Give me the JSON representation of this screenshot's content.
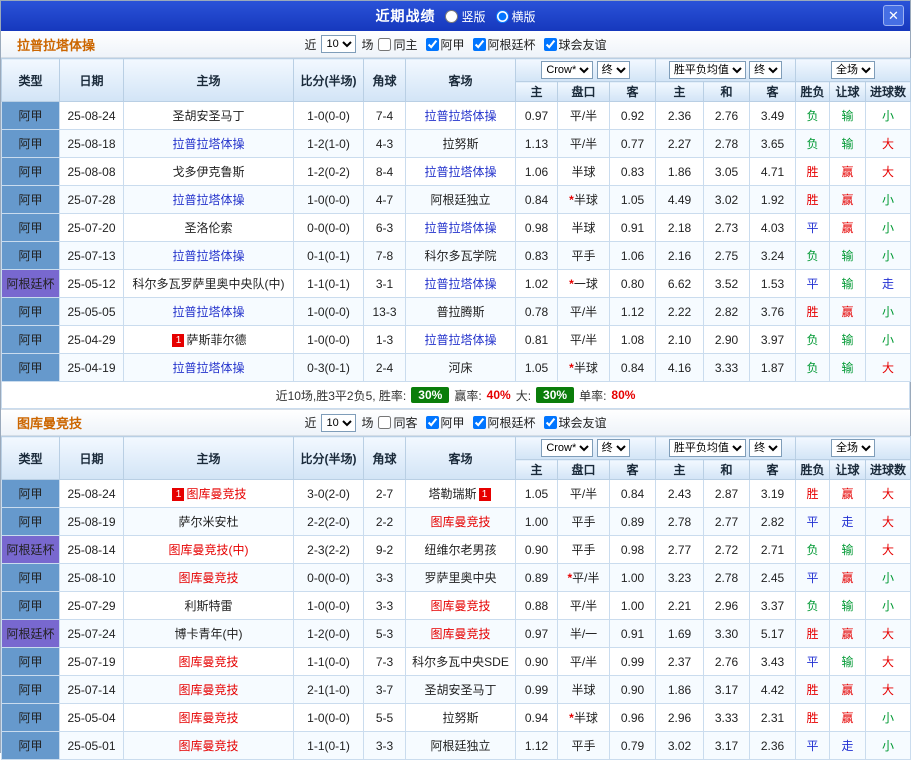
{
  "topbar": {
    "title": "近期战绩",
    "layout_options": [
      {
        "label": "竖版",
        "selected": false
      },
      {
        "label": "横版",
        "selected": true
      }
    ],
    "close_label": "✕"
  },
  "filters_common": {
    "near": "近",
    "count": "10",
    "games": "场"
  },
  "header": {
    "col_type": "类型",
    "col_date": "日期",
    "col_home": "主场",
    "col_score": "比分(半场)",
    "col_corner": "角球",
    "col_away": "客场",
    "odds_book": "Crow*",
    "odds_final": "终",
    "avg_name": "胜平负均值",
    "avg_final": "终",
    "full": "全场",
    "sub_home": "主",
    "sub_handicap": "盘口",
    "sub_away": "客",
    "sub_h": "主",
    "sub_d": "和",
    "sub_a": "客",
    "sub_result": "胜负",
    "sub_handicap_result": "让球",
    "sub_goals": "进球数"
  },
  "colors": {
    "topbar_bg": "#1c43cb",
    "league": {
      "阿甲": "#6699cc",
      "阿根廷杯": "#7868cf"
    },
    "result": {
      "胜": "#e60000",
      "赢": "#e60000",
      "大": "#e60000",
      "负": "#009933",
      "输": "#009933",
      "小": "#009933",
      "平": "#2230d2",
      "走": "#2230d2"
    },
    "score": "#e60000",
    "star": "#e60000",
    "badge_green": "#0a7d0a"
  },
  "sections": [
    {
      "title": "拉普拉塔体操",
      "focus_color": "#2433cc",
      "filters": [
        {
          "label": "同主",
          "checked": false
        },
        {
          "label": "阿甲",
          "checked": true
        },
        {
          "label": "阿根廷杯",
          "checked": true
        },
        {
          "label": "球会友谊",
          "checked": true
        }
      ],
      "rows": [
        {
          "type": "阿甲",
          "date": "25-08-24",
          "home": {
            "name": "圣胡安圣马丁"
          },
          "score": "1-0(0-0)",
          "corners": "7-4",
          "away": {
            "name": "拉普拉塔体操",
            "focus": true
          },
          "odds": [
            "0.97",
            "平/半",
            "0.92"
          ],
          "avg": [
            "2.36",
            "2.76",
            "3.49"
          ],
          "result": [
            "负",
            "输",
            "小"
          ]
        },
        {
          "type": "阿甲",
          "date": "25-08-18",
          "home": {
            "name": "拉普拉塔体操",
            "focus": true
          },
          "score": "1-2(1-0)",
          "corners": "4-3",
          "away": {
            "name": "拉努斯"
          },
          "odds": [
            "1.13",
            "平/半",
            "0.77"
          ],
          "avg": [
            "2.27",
            "2.78",
            "3.65"
          ],
          "result": [
            "负",
            "输",
            "大"
          ]
        },
        {
          "type": "阿甲",
          "date": "25-08-08",
          "home": {
            "name": "戈多伊克鲁斯"
          },
          "score": "1-2(0-2)",
          "corners": "8-4",
          "away": {
            "name": "拉普拉塔体操",
            "focus": true
          },
          "odds": [
            "1.06",
            "半球",
            "0.83"
          ],
          "avg": [
            "1.86",
            "3.05",
            "4.71"
          ],
          "result": [
            "胜",
            "赢",
            "大"
          ]
        },
        {
          "type": "阿甲",
          "date": "25-07-28",
          "home": {
            "name": "拉普拉塔体操",
            "focus": true
          },
          "score": "1-0(0-0)",
          "corners": "4-7",
          "away": {
            "name": "阿根廷独立"
          },
          "odds": [
            "0.84",
            "*半球",
            "1.05"
          ],
          "avg": [
            "4.49",
            "3.02",
            "1.92"
          ],
          "result": [
            "胜",
            "赢",
            "小"
          ]
        },
        {
          "type": "阿甲",
          "date": "25-07-20",
          "home": {
            "name": "圣洛伦索"
          },
          "score": "0-0(0-0)",
          "corners": "6-3",
          "away": {
            "name": "拉普拉塔体操",
            "focus": true
          },
          "odds": [
            "0.98",
            "半球",
            "0.91"
          ],
          "avg": [
            "2.18",
            "2.73",
            "4.03"
          ],
          "result": [
            "平",
            "赢",
            "小"
          ]
        },
        {
          "type": "阿甲",
          "date": "25-07-13",
          "home": {
            "name": "拉普拉塔体操",
            "focus": true
          },
          "score": "0-1(0-1)",
          "corners": "7-8",
          "away": {
            "name": "科尔多瓦学院"
          },
          "odds": [
            "0.83",
            "平手",
            "1.06"
          ],
          "avg": [
            "2.16",
            "2.75",
            "3.24"
          ],
          "result": [
            "负",
            "输",
            "小"
          ]
        },
        {
          "type": "阿根廷杯",
          "date": "25-05-12",
          "home": {
            "name": "科尔多瓦罗萨里奥中央队(中)"
          },
          "score": "1-1(0-1)",
          "corners": "3-1",
          "away": {
            "name": "拉普拉塔体操",
            "focus": true
          },
          "odds": [
            "1.02",
            "*一球",
            "0.80"
          ],
          "avg": [
            "6.62",
            "3.52",
            "1.53"
          ],
          "result": [
            "平",
            "输",
            "走"
          ]
        },
        {
          "type": "阿甲",
          "date": "25-05-05",
          "home": {
            "name": "拉普拉塔体操",
            "focus": true
          },
          "score": "1-0(0-0)",
          "corners": "13-3",
          "away": {
            "name": "普拉腾斯"
          },
          "odds": [
            "0.78",
            "平/半",
            "1.12"
          ],
          "avg": [
            "2.22",
            "2.82",
            "3.76"
          ],
          "result": [
            "胜",
            "赢",
            "小"
          ]
        },
        {
          "type": "阿甲",
          "date": "25-04-29",
          "home": {
            "name": "萨斯菲尔德",
            "card": "before"
          },
          "score": "1-0(0-0)",
          "corners": "1-3",
          "away": {
            "name": "拉普拉塔体操",
            "focus": true
          },
          "odds": [
            "0.81",
            "平/半",
            "1.08"
          ],
          "avg": [
            "2.10",
            "2.90",
            "3.97"
          ],
          "result": [
            "负",
            "输",
            "小"
          ]
        },
        {
          "type": "阿甲",
          "date": "25-04-19",
          "home": {
            "name": "拉普拉塔体操",
            "focus": true
          },
          "score": "0-3(0-1)",
          "corners": "2-4",
          "away": {
            "name": "河床"
          },
          "odds": [
            "1.05",
            "*半球",
            "0.84"
          ],
          "avg": [
            "4.16",
            "3.33",
            "1.87"
          ],
          "result": [
            "负",
            "输",
            "大"
          ]
        }
      ],
      "summary": {
        "part1": "近10场,胜3平2负5, 胜率:",
        "rate1": "30%",
        "part2": "赢率:",
        "rate2": "40%",
        "part3": "大:",
        "rate3": "30%",
        "part4": "单率:",
        "rate4": "80%"
      }
    },
    {
      "title": "图库曼竞技",
      "focus_color": "#e60000",
      "filters": [
        {
          "label": "同客",
          "checked": false
        },
        {
          "label": "阿甲",
          "checked": true
        },
        {
          "label": "阿根廷杯",
          "checked": true
        },
        {
          "label": "球会友谊",
          "checked": true
        }
      ],
      "rows": [
        {
          "type": "阿甲",
          "date": "25-08-24",
          "home": {
            "name": "图库曼竞技",
            "focus": true,
            "card": "before"
          },
          "score": "3-0(2-0)",
          "corners": "2-7",
          "away": {
            "name": "塔勒瑞斯",
            "card": "after"
          },
          "odds": [
            "1.05",
            "平/半",
            "0.84"
          ],
          "avg": [
            "2.43",
            "2.87",
            "3.19"
          ],
          "result": [
            "胜",
            "赢",
            "大"
          ]
        },
        {
          "type": "阿甲",
          "date": "25-08-19",
          "home": {
            "name": "萨尔米安杜"
          },
          "score": "2-2(2-0)",
          "corners": "2-2",
          "away": {
            "name": "图库曼竞技",
            "focus": true
          },
          "odds": [
            "1.00",
            "平手",
            "0.89"
          ],
          "avg": [
            "2.78",
            "2.77",
            "2.82"
          ],
          "result": [
            "平",
            "走",
            "大"
          ]
        },
        {
          "type": "阿根廷杯",
          "date": "25-08-14",
          "home": {
            "name": "图库曼竞技(中)",
            "focus": true
          },
          "score": "2-3(2-2)",
          "corners": "9-2",
          "away": {
            "name": "纽维尔老男孩"
          },
          "odds": [
            "0.90",
            "平手",
            "0.98"
          ],
          "avg": [
            "2.77",
            "2.72",
            "2.71"
          ],
          "result": [
            "负",
            "输",
            "大"
          ]
        },
        {
          "type": "阿甲",
          "date": "25-08-10",
          "home": {
            "name": "图库曼竞技",
            "focus": true
          },
          "score": "0-0(0-0)",
          "corners": "3-3",
          "away": {
            "name": "罗萨里奥中央"
          },
          "odds": [
            "0.89",
            "*平/半",
            "1.00"
          ],
          "avg": [
            "3.23",
            "2.78",
            "2.45"
          ],
          "result": [
            "平",
            "赢",
            "小"
          ]
        },
        {
          "type": "阿甲",
          "date": "25-07-29",
          "home": {
            "name": "利斯特雷"
          },
          "score": "1-0(0-0)",
          "corners": "3-3",
          "away": {
            "name": "图库曼竞技",
            "focus": true
          },
          "odds": [
            "0.88",
            "平/半",
            "1.00"
          ],
          "avg": [
            "2.21",
            "2.96",
            "3.37"
          ],
          "result": [
            "负",
            "输",
            "小"
          ]
        },
        {
          "type": "阿根廷杯",
          "date": "25-07-24",
          "home": {
            "name": "博卡青年(中)"
          },
          "score": "1-2(0-0)",
          "corners": "5-3",
          "away": {
            "name": "图库曼竞技",
            "focus": true
          },
          "odds": [
            "0.97",
            "半/一",
            "0.91"
          ],
          "avg": [
            "1.69",
            "3.30",
            "5.17"
          ],
          "result": [
            "胜",
            "赢",
            "大"
          ]
        },
        {
          "type": "阿甲",
          "date": "25-07-19",
          "home": {
            "name": "图库曼竞技",
            "focus": true
          },
          "score": "1-1(0-0)",
          "corners": "7-3",
          "away": {
            "name": "科尔多瓦中央SDE"
          },
          "odds": [
            "0.90",
            "平/半",
            "0.99"
          ],
          "avg": [
            "2.37",
            "2.76",
            "3.43"
          ],
          "result": [
            "平",
            "输",
            "大"
          ]
        },
        {
          "type": "阿甲",
          "date": "25-07-14",
          "home": {
            "name": "图库曼竞技",
            "focus": true
          },
          "score": "2-1(1-0)",
          "corners": "3-7",
          "away": {
            "name": "圣胡安圣马丁"
          },
          "odds": [
            "0.99",
            "半球",
            "0.90"
          ],
          "avg": [
            "1.86",
            "3.17",
            "4.42"
          ],
          "result": [
            "胜",
            "赢",
            "大"
          ]
        },
        {
          "type": "阿甲",
          "date": "25-05-04",
          "home": {
            "name": "图库曼竞技",
            "focus": true
          },
          "score": "1-0(0-0)",
          "corners": "5-5",
          "away": {
            "name": "拉努斯"
          },
          "odds": [
            "0.94",
            "*半球",
            "0.96"
          ],
          "avg": [
            "2.96",
            "3.33",
            "2.31"
          ],
          "result": [
            "胜",
            "赢",
            "小"
          ]
        },
        {
          "type": "阿甲",
          "date": "25-05-01",
          "home": {
            "name": "图库曼竞技",
            "focus": true
          },
          "score": "1-1(0-1)",
          "corners": "3-3",
          "away": {
            "name": "阿根廷独立"
          },
          "odds": [
            "1.12",
            "平手",
            "0.79"
          ],
          "avg": [
            "3.02",
            "3.17",
            "2.36"
          ],
          "result": [
            "平",
            "走",
            "小"
          ]
        }
      ]
    }
  ]
}
